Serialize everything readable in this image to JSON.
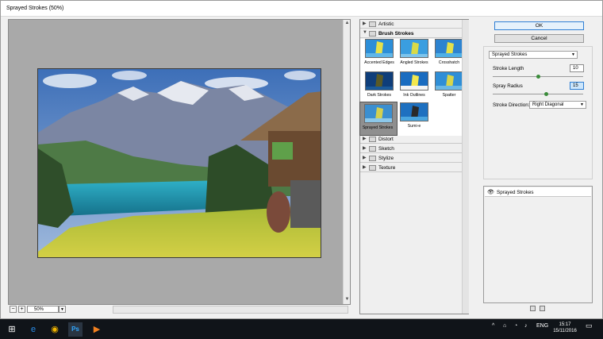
{
  "window": {
    "title": "Sprayed Strokes (50%)"
  },
  "preview": {
    "zoom": "50%"
  },
  "gallery": {
    "categories": [
      {
        "label": "Artistic",
        "open": false
      },
      {
        "label": "Brush Strokes",
        "open": true
      },
      {
        "label": "Distort",
        "open": false
      },
      {
        "label": "Sketch",
        "open": false
      },
      {
        "label": "Stylize",
        "open": false
      },
      {
        "label": "Texture",
        "open": false
      }
    ],
    "filters": [
      {
        "label": "Accented Edges"
      },
      {
        "label": "Angled Strokes"
      },
      {
        "label": "Crosshatch"
      },
      {
        "label": "Dark Strokes"
      },
      {
        "label": "Ink Outlines"
      },
      {
        "label": "Spatter"
      },
      {
        "label": "Sprayed Strokes",
        "selected": true
      },
      {
        "label": "Sumi-e"
      }
    ]
  },
  "buttons": {
    "ok": "OK",
    "cancel": "Cancel"
  },
  "settings": {
    "filter_select": "Sprayed Strokes",
    "stroke_length": {
      "label": "Stroke Length",
      "value": "10",
      "fraction": 0.5
    },
    "spray_radius": {
      "label": "Spray Radius",
      "value": "15",
      "fraction": 0.6
    },
    "stroke_direction": {
      "label": "Stroke Direction:",
      "value": "Right Diagonal"
    }
  },
  "layers": {
    "items": [
      {
        "label": "Sprayed Strokes"
      }
    ]
  },
  "taskbar": {
    "time": "15:17",
    "date": "15/11/2016",
    "lang": "ENG"
  },
  "colors": {
    "accent": "#2f7fd4",
    "slider_knob": "#3a8c3a",
    "taskbar": "#101419"
  }
}
